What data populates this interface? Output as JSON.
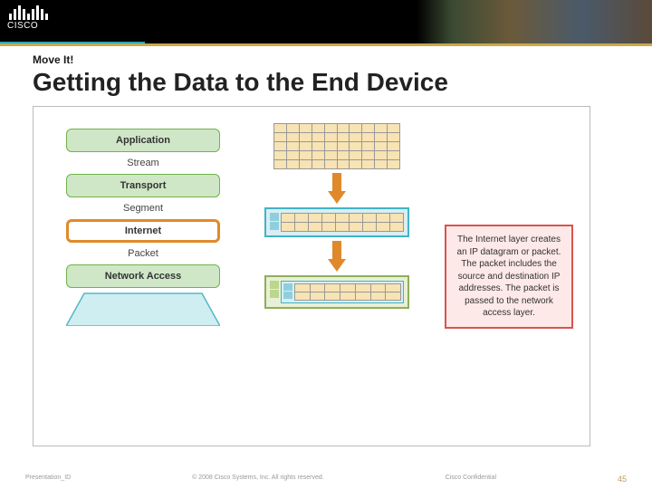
{
  "brand": {
    "name": "CISCO"
  },
  "kicker": "Move It!",
  "title": "Getting the Data to the End Device",
  "layers": {
    "application": "Application",
    "transport": "Transport",
    "internet": "Internet",
    "network_access": "Network Access"
  },
  "pdus": {
    "stream": "Stream",
    "segment": "Segment",
    "packet": "Packet"
  },
  "callout": "The Internet layer creates an IP datagram or packet. The packet includes the source and destination IP addresses. The packet is passed to the network access layer.",
  "footer": {
    "left": "Presentation_ID",
    "center": "© 2008 Cisco Systems, Inc. All rights reserved.",
    "right": "Cisco Confidential",
    "page": "45"
  }
}
